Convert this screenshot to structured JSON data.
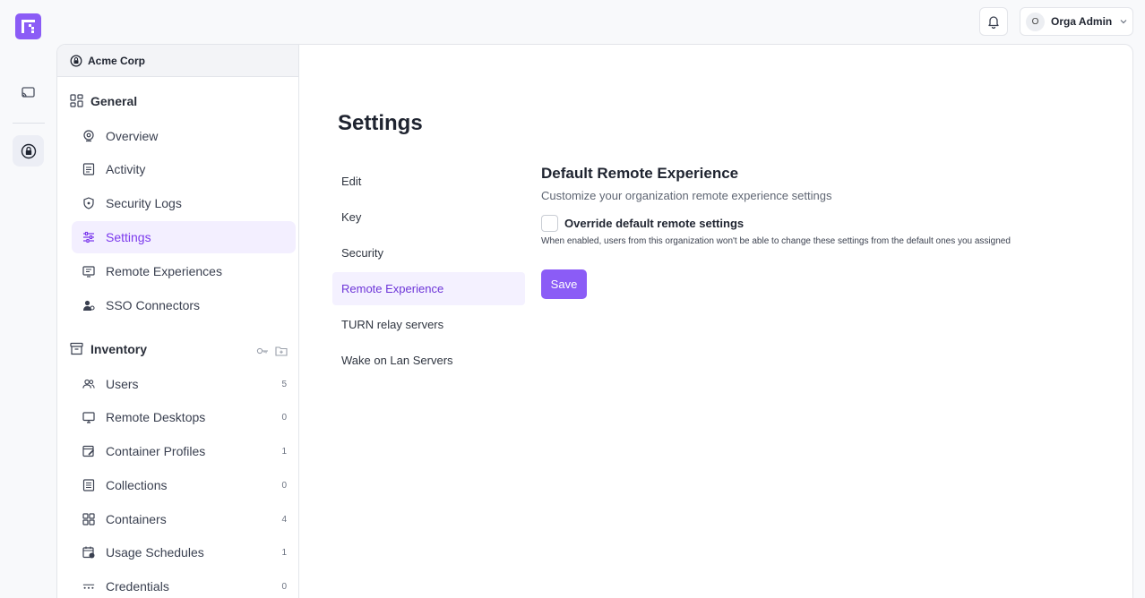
{
  "topbar": {
    "user_initial": "O",
    "user_name": "Orga Admin"
  },
  "sidebar": {
    "org_name": "Acme Corp",
    "general_title": "General",
    "general_items": [
      {
        "label": "Overview",
        "icon": "overview-icon"
      },
      {
        "label": "Activity",
        "icon": "activity-icon"
      },
      {
        "label": "Security Logs",
        "icon": "security-logs-icon"
      },
      {
        "label": "Settings",
        "icon": "settings-sliders-icon",
        "active": true
      },
      {
        "label": "Remote Experiences",
        "icon": "remote-experiences-icon"
      },
      {
        "label": "SSO Connectors",
        "icon": "sso-connectors-icon"
      }
    ],
    "inventory_title": "Inventory",
    "inventory_items": [
      {
        "label": "Users",
        "count": "5",
        "icon": "users-icon"
      },
      {
        "label": "Remote Desktops",
        "count": "0",
        "icon": "monitor-icon"
      },
      {
        "label": "Container Profiles",
        "count": "1",
        "icon": "container-profiles-icon"
      },
      {
        "label": "Collections",
        "count": "0",
        "icon": "collections-icon"
      },
      {
        "label": "Containers",
        "count": "4",
        "icon": "containers-icon"
      },
      {
        "label": "Usage Schedules",
        "count": "1",
        "icon": "calendar-clock-icon"
      },
      {
        "label": "Credentials",
        "count": "0",
        "icon": "credentials-icon"
      }
    ]
  },
  "main": {
    "page_title": "Settings",
    "subnav": [
      {
        "label": "Edit"
      },
      {
        "label": "Key"
      },
      {
        "label": "Security"
      },
      {
        "label": "Remote Experience",
        "active": true
      },
      {
        "label": "TURN relay servers"
      },
      {
        "label": "Wake on Lan Servers"
      }
    ],
    "panel": {
      "title": "Default Remote Experience",
      "subtitle": "Customize your organization remote experience settings",
      "checkbox_label": "Override default remote settings",
      "checkbox_checked": false,
      "checkbox_help": "When enabled, users from this organization won't be able to change these settings from the default ones you assigned",
      "save_label": "Save"
    }
  },
  "colors": {
    "accent": "#8b5cf6",
    "active_bg": "#f3efff",
    "active_text": "#7c3aed"
  }
}
